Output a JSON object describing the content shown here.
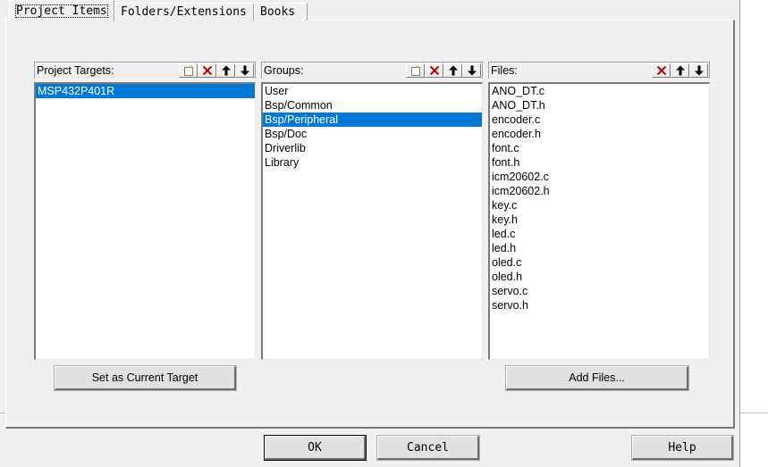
{
  "tabs": [
    {
      "label": "Project Items",
      "active": true
    },
    {
      "label": "Folders/Extensions",
      "active": false
    },
    {
      "label": "Books",
      "active": false
    }
  ],
  "targets": {
    "title": "Project Targets:",
    "items": [
      "MSP432P401R"
    ],
    "selected_index": 0
  },
  "groups": {
    "title": "Groups:",
    "items": [
      "User",
      "Bsp/Common",
      "Bsp/Peripheral",
      "Bsp/Doc",
      "Driverlib",
      "Library"
    ],
    "selected_index": 2
  },
  "files": {
    "title": "Files:",
    "items": [
      "ANO_DT.c",
      "ANO_DT.h",
      "encoder.c",
      "encoder.h",
      "font.c",
      "font.h",
      "icm20602.c",
      "icm20602.h",
      "key.c",
      "key.h",
      "led.c",
      "led.h",
      "oled.c",
      "oled.h",
      "servo.c",
      "servo.h"
    ],
    "selected_index": -1
  },
  "buttons": {
    "set_current_target": "Set as Current Target",
    "add_files": "Add Files...",
    "ok": "OK",
    "cancel": "Cancel",
    "help": "Help"
  },
  "colors": {
    "selection": "#0078d7",
    "delete_icon": "#c00000"
  }
}
